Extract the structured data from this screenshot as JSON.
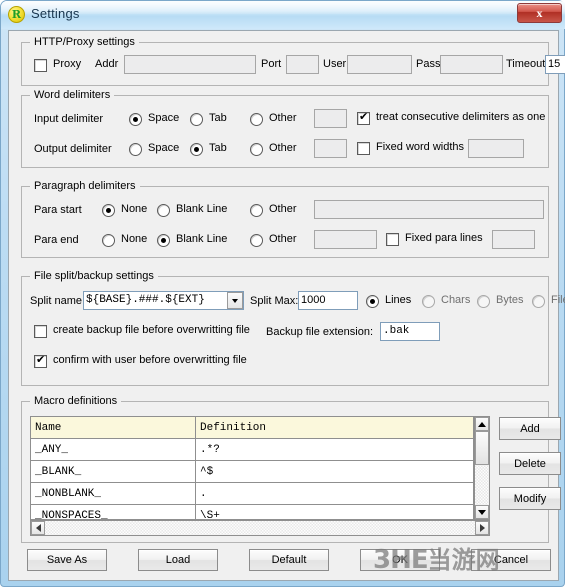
{
  "window": {
    "title": "Settings",
    "icon": "app-r-icon",
    "close_label": "x"
  },
  "proxy_group": {
    "legend": "HTTP/Proxy settings",
    "proxy_checkbox": "Proxy",
    "proxy_checked": false,
    "addr_label": "Addr",
    "addr_value": "",
    "port_label": "Port",
    "port_value": "",
    "user_label": "User",
    "user_value": "",
    "pass_label": "Pass",
    "pass_value": "",
    "timeout_label": "Timeout",
    "timeout_value": "15"
  },
  "word_group": {
    "legend": "Word delimiters",
    "input_label": "Input    delimiter",
    "output_label": "Output delimiter",
    "input_space": "Space",
    "input_tab": "Tab",
    "input_other": "Other",
    "input_other_value": "",
    "input_selected": "Space",
    "output_space": "Space",
    "output_tab": "Tab",
    "output_other": "Other",
    "output_other_value": "",
    "output_selected": "Tab",
    "consecutive_label": "treat consecutive delimiters as one",
    "consecutive_checked": true,
    "fixed_width_label": "Fixed word widths",
    "fixed_width_checked": false,
    "fixed_width_value": ""
  },
  "para_group": {
    "legend": "Paragraph delimiters",
    "start_label": "Para start",
    "end_label": "Para end",
    "start_none": "None",
    "start_blank": "Blank Line",
    "start_other": "Other",
    "start_other_value": "",
    "start_selected": "None",
    "end_none": "None",
    "end_blank": "Blank Line",
    "end_other": "Other",
    "end_other_value": "",
    "end_selected": "Blank Line",
    "fixed_lines_label": "Fixed para lines",
    "fixed_lines_checked": false,
    "fixed_lines_value": ""
  },
  "split_group": {
    "legend": "File split/backup settings",
    "split_name_label": "Split name:",
    "split_name_value": "${BASE}.###.${EXT}",
    "split_max_label": "Split Max:",
    "split_max_value": "1000",
    "unit_lines": "Lines",
    "unit_chars": "Chars",
    "unit_bytes": "Bytes",
    "unit_files": "Files",
    "unit_selected": "Lines",
    "create_backup_label": "create backup file before overwritting file",
    "create_backup_checked": false,
    "backup_ext_label": "Backup file extension:",
    "backup_ext_value": ".bak",
    "confirm_label": "confirm with user before overwritting file",
    "confirm_checked": true
  },
  "macro_group": {
    "legend": "Macro definitions",
    "columns": [
      "Name",
      "Definition"
    ],
    "rows": [
      {
        "name": "_ANY_",
        "definition": ".*?"
      },
      {
        "name": "_BLANK_",
        "definition": "^$"
      },
      {
        "name": "_NONBLANK_",
        "definition": "."
      },
      {
        "name": "_NONSPACES_",
        "definition": "\\S+"
      }
    ],
    "add_label": "Add",
    "delete_label": "Delete",
    "modify_label": "Modify"
  },
  "footer": {
    "save_as": "Save As",
    "load": "Load",
    "default": "Default",
    "ok": "OK",
    "cancel": "Cancel"
  },
  "watermark": {
    "latin": "3HE",
    "chinese": "当游网"
  }
}
